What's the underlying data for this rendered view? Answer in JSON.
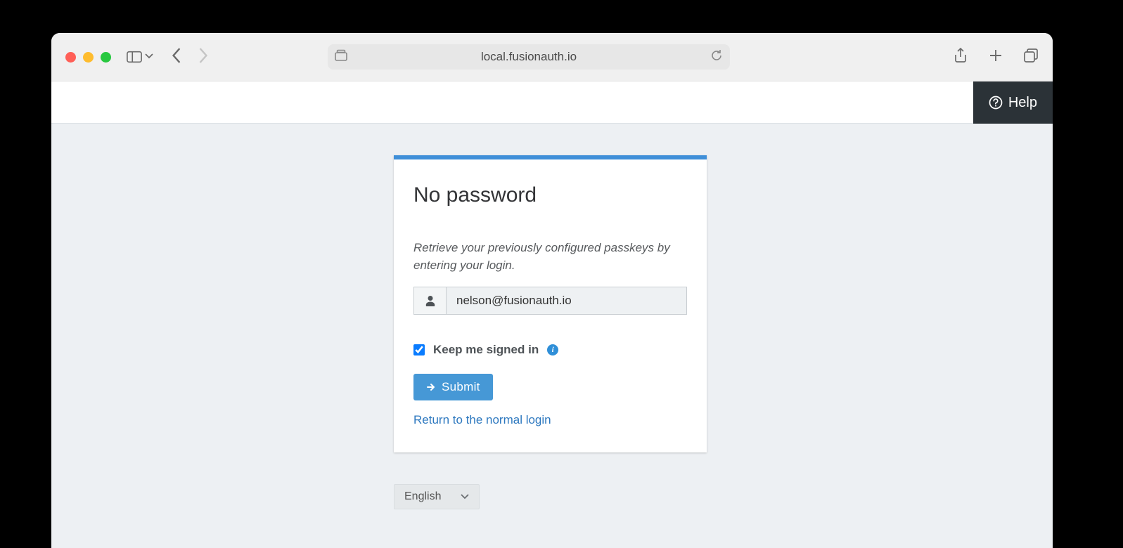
{
  "browser": {
    "url_display": "local.fusionauth.io"
  },
  "topbar": {
    "help_label": "Help"
  },
  "card": {
    "title": "No password",
    "instruction": "Retrieve your previously configured passkeys by entering your login.",
    "email_value": "nelson@fusionauth.io",
    "keep_signed_label": "Keep me signed in",
    "submit_label": "Submit",
    "return_link_label": "Return to the normal login"
  },
  "language": {
    "selected": "English"
  }
}
